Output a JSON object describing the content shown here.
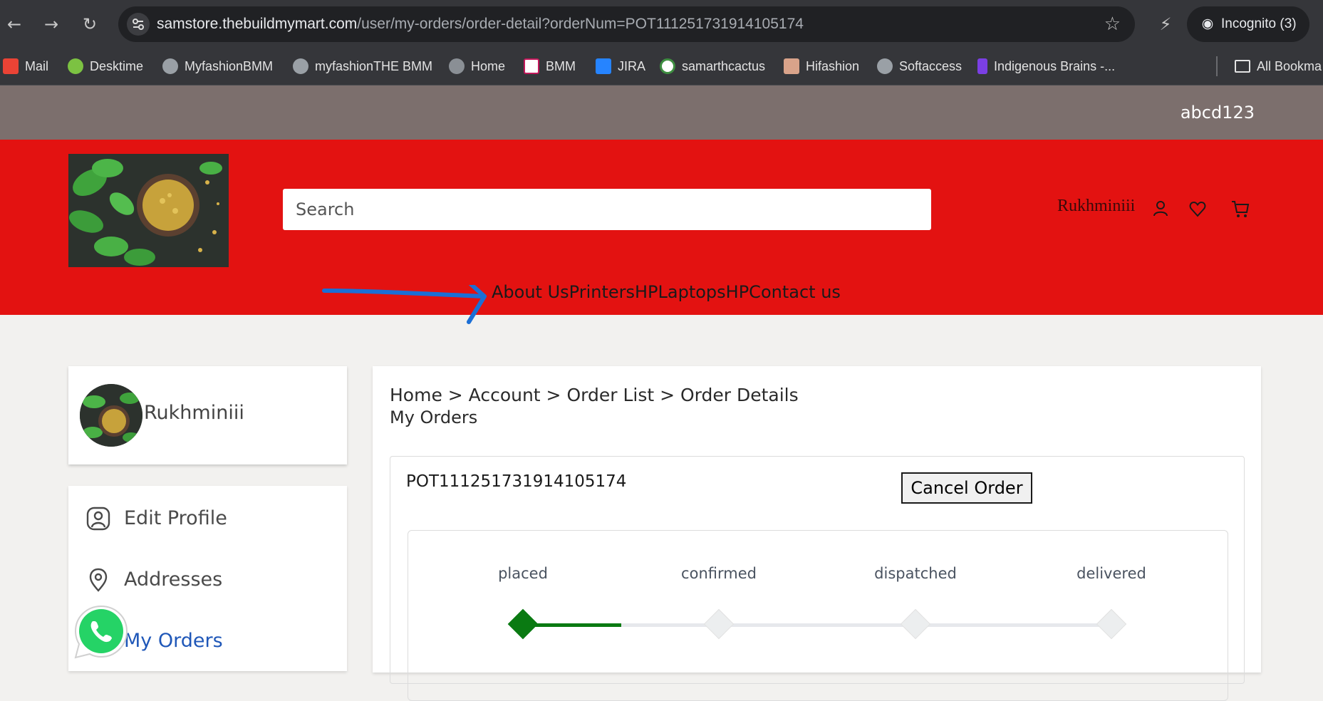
{
  "browser": {
    "url_host": "samstore.thebuildmymart.com",
    "url_path": "/user/my-orders/order-detail?orderNum=POT111251731914105174",
    "incognito_label": "Incognito (3)",
    "bookmarks": [
      {
        "label": "Mail",
        "icon": "gmail-icon",
        "color": "#ea4335"
      },
      {
        "label": "Desktime",
        "icon": "desktime-icon",
        "color": "#7cc242"
      },
      {
        "label": "MyfashionBMM",
        "icon": "globe-icon",
        "color": "#9aa0a6"
      },
      {
        "label": "myfashionTHE BMM",
        "icon": "globe-icon",
        "color": "#9aa0a6"
      },
      {
        "label": "Home",
        "icon": "globe-icon",
        "color": "#9aa0a6"
      },
      {
        "label": "BMM",
        "icon": "bmm-icon",
        "color": "#c2185b"
      },
      {
        "label": "JIRA",
        "icon": "jira-icon",
        "color": "#2684ff"
      },
      {
        "label": "samarthcactus",
        "icon": "cactus-icon",
        "color": "#3e8e41"
      },
      {
        "label": "Hifashion",
        "icon": "hifashion-icon",
        "color": "#d9a38a"
      },
      {
        "label": "Softaccess",
        "icon": "globe-icon",
        "color": "#9aa0a6"
      },
      {
        "label": "Indigenous Brains -...",
        "icon": "indigenous-icon",
        "color": "#7b3fe4"
      }
    ],
    "all_bookmarks_label": "All Bookma"
  },
  "site": {
    "topbar_user": "abcd123",
    "search_placeholder": "Search",
    "header_user": "Rukhminiii",
    "menu_text": "About UsPrintersHPLaptopsHPContact us",
    "colors": {
      "header": "#e31211",
      "topbar": "#7c6f6d",
      "accent": "#0a7a12",
      "active_link": "#1f57b8"
    }
  },
  "sidebar": {
    "profile_name": "Rukhminiii",
    "items": [
      {
        "label": "Edit Profile",
        "icon": "user-icon"
      },
      {
        "label": "Addresses",
        "icon": "location-pin-icon"
      },
      {
        "label": "My Orders",
        "icon": "orders-icon"
      }
    ]
  },
  "main": {
    "breadcrumb": "Home > Account > Order List > Order Details",
    "title": "My Orders",
    "order_number": "POT111251731914105174",
    "cancel_label": "Cancel Order",
    "steps": [
      "placed",
      "confirmed",
      "dispatched",
      "delivered"
    ],
    "completed_steps": 1
  }
}
